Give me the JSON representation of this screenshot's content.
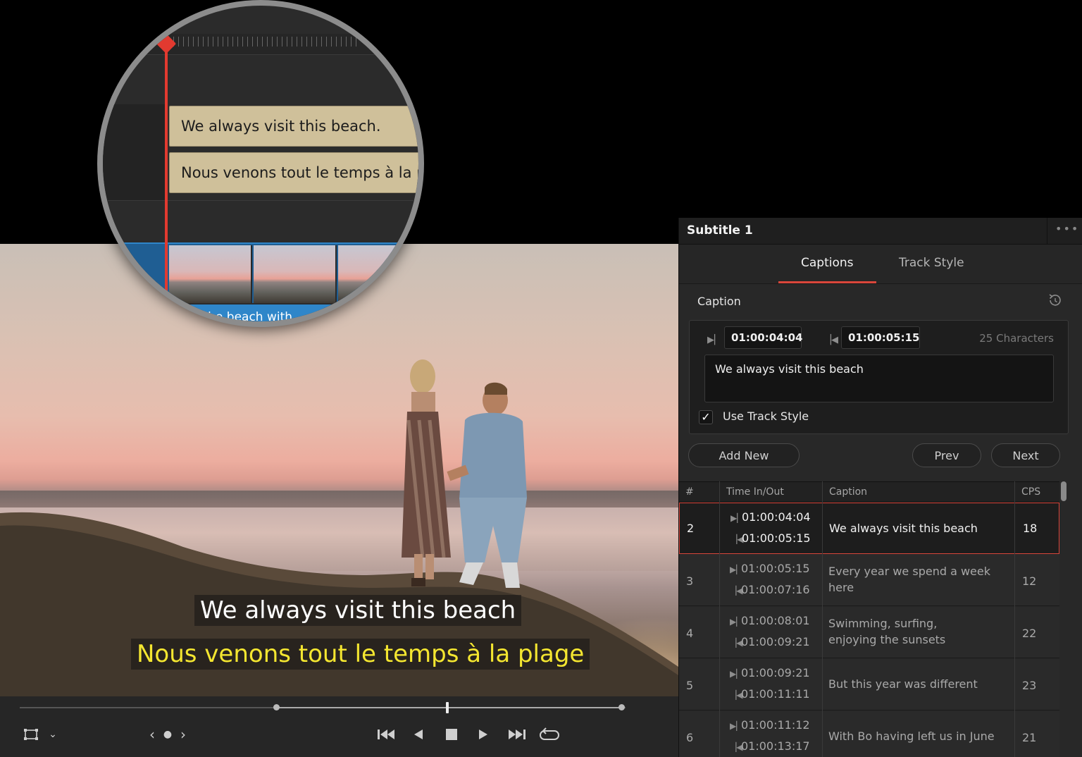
{
  "viewer": {
    "subtitle_primary": "We always visit this beach",
    "subtitle_secondary": "Nous venons tout le temps à la plage"
  },
  "magnifier": {
    "clip1": "We always visit this beach.",
    "clip2": "Nous venons tout le temps à la pla",
    "audio_clip": "at the beach with"
  },
  "panel": {
    "title": "Subtitle 1",
    "tabs": [
      "Captions",
      "Track Style"
    ],
    "active_tab": "Captions",
    "section": "Caption",
    "time_in": "01:00:04:04",
    "time_out": "01:00:05:15",
    "char_count": "25 Characters",
    "caption_text": "We always visit this beach",
    "use_track_style_label": "Use Track Style",
    "use_track_style_checked": true,
    "buttons": {
      "add_new": "Add New",
      "prev": "Prev",
      "next": "Next"
    },
    "table": {
      "headers": [
        "#",
        "Time In/Out",
        "Caption",
        "CPS"
      ],
      "rows": [
        {
          "num": "2",
          "in": "01:00:04:04",
          "out": "01:00:05:15",
          "caption": "We always visit this beach",
          "cps": "18",
          "selected": true
        },
        {
          "num": "3",
          "in": "01:00:05:15",
          "out": "01:00:07:16",
          "caption": "Every year we spend a week here",
          "cps": "12"
        },
        {
          "num": "4",
          "in": "01:00:08:01",
          "out": "01:00:09:21",
          "caption": "Swimming, surfing, enjoying the sunsets",
          "cps": "22"
        },
        {
          "num": "5",
          "in": "01:00:09:21",
          "out": "01:00:11:11",
          "caption": "But this year was different",
          "cps": "23"
        },
        {
          "num": "6",
          "in": "01:00:11:12",
          "out": "01:00:13:17",
          "caption": "With Bo having left us in June",
          "cps": "21"
        }
      ]
    }
  },
  "colors": {
    "accent": "#d9463b",
    "subtitle_yellow": "#f4e630",
    "clip": "#cfc09a",
    "timeline_blue": "#2f86c9"
  },
  "icons": [
    "viewer-framing-icon",
    "chevron-down-icon",
    "prev-icon",
    "dot-icon",
    "next-icon",
    "go-to-start-icon",
    "play-reverse-icon",
    "stop-icon",
    "play-icon",
    "go-to-end-icon",
    "loop-icon",
    "reset-icon",
    "mark-in-icon",
    "mark-out-icon",
    "more-icon",
    "checkmark-icon"
  ]
}
